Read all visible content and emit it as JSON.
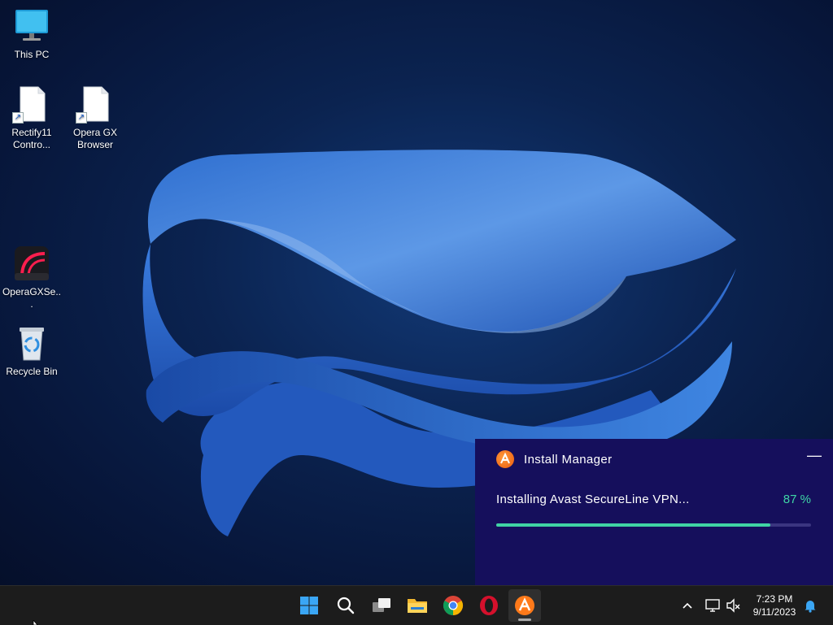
{
  "desktop": {
    "icons": [
      {
        "label": "This PC",
        "icon": "monitor-icon"
      },
      {
        "label": "Rectify11 Contro...",
        "icon": "file-shortcut-icon"
      },
      {
        "label": "Opera GX Browser",
        "icon": "file-shortcut-icon"
      },
      {
        "label": "OperaGXSe...",
        "icon": "opera-gx-setup-icon"
      },
      {
        "label": "Recycle Bin",
        "icon": "recycle-bin-icon"
      }
    ]
  },
  "install_manager": {
    "title": "Install Manager",
    "minimize_label": "—",
    "status_text": "Installing Avast SecureLine VPN...",
    "percent_text": "87 %",
    "progress": 0.87,
    "colors": {
      "background": "#150f5c",
      "accent": "#40d3a4",
      "logo": "#ea5a0c"
    }
  },
  "taskbar": {
    "pinned": [
      {
        "name": "start",
        "icon": "windows-logo-icon"
      },
      {
        "name": "search",
        "icon": "search-icon"
      },
      {
        "name": "task-view",
        "icon": "task-view-icon"
      },
      {
        "name": "file-explorer",
        "icon": "folder-icon"
      },
      {
        "name": "chrome",
        "icon": "chrome-icon"
      },
      {
        "name": "opera",
        "icon": "opera-icon"
      },
      {
        "name": "avast",
        "icon": "avast-icon",
        "active": true
      }
    ],
    "tray": {
      "chevron": "^",
      "icons": [
        "network-icon",
        "volume-muted-icon",
        "notification-bell-icon"
      ]
    },
    "clock": {
      "time": "7:23 PM",
      "date": "9/11/2023"
    }
  }
}
